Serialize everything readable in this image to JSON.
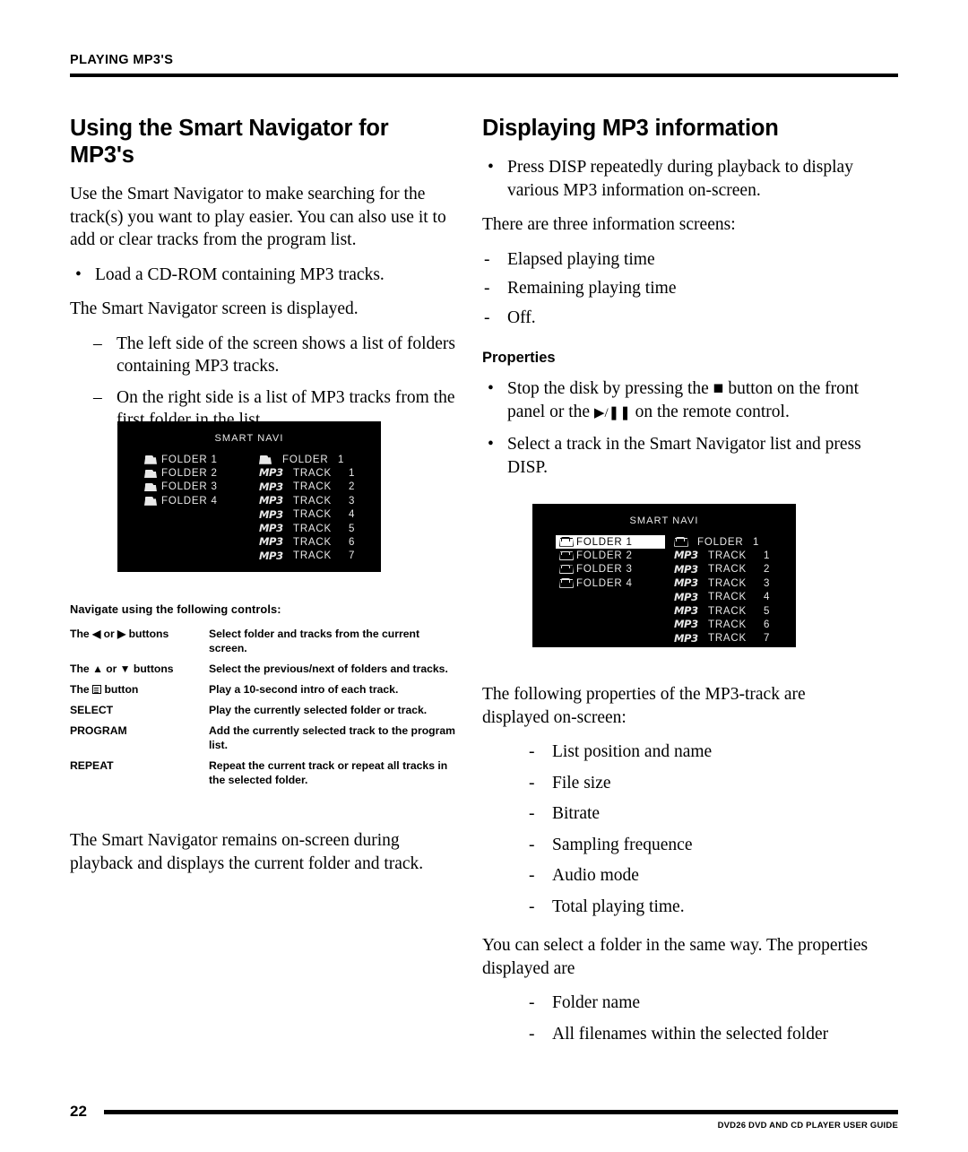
{
  "running_head": "PLAYING MP3'S",
  "left_column": {
    "title": "Using the Smart Navigator for MP3's",
    "intro": "Use the Smart Navigator to make searching for the track(s) you want to play easier. You can also use it to add or clear tracks from the program list.",
    "bullets": [
      {
        "marker": "•",
        "text": "Load a CD-ROM containing MP3 tracks."
      }
    ],
    "after_bullet": "The Smart Navigator screen is displayed.",
    "sub_items": [
      {
        "marker": "–",
        "text": "The left side of the screen shows a list of folders containing MP3 tracks."
      },
      {
        "marker": "–",
        "text": "On the right side is a list of MP3 tracks from the first folder in the list."
      }
    ],
    "tail": "The Smart Navigator remains on-screen during playback and displays the current folder and track."
  },
  "osd_screen_1": {
    "title": "SMART NAVI",
    "folders": [
      {
        "icon": "folder-icon",
        "label": "FOLDER 1",
        "highlighted": false
      },
      {
        "icon": "folder-icon",
        "label": "FOLDER 2",
        "highlighted": false
      },
      {
        "icon": "folder-icon",
        "label": "FOLDER 3",
        "highlighted": false
      },
      {
        "icon": "folder-icon",
        "label": "FOLDER 4",
        "highlighted": false
      }
    ],
    "tracks": [
      {
        "icon": "folder-icon",
        "label": "FOLDER",
        "number": "1"
      },
      {
        "icon": "mp3-icon",
        "label": "TRACK",
        "number": "1"
      },
      {
        "icon": "mp3-icon",
        "label": "TRACK",
        "number": "2"
      },
      {
        "icon": "mp3-icon",
        "label": "TRACK",
        "number": "3"
      },
      {
        "icon": "mp3-icon",
        "label": "TRACK",
        "number": "4"
      },
      {
        "icon": "mp3-icon",
        "label": "TRACK",
        "number": "5"
      },
      {
        "icon": "mp3-icon",
        "label": "TRACK",
        "number": "6"
      },
      {
        "icon": "mp3-icon",
        "label": "TRACK",
        "number": "7"
      }
    ],
    "mp3_glyph": "MP3"
  },
  "osd_screen_2": {
    "title": "SMART NAVI",
    "folders": [
      {
        "icon": "folder-icon",
        "label": "FOLDER 1",
        "highlighted": true
      },
      {
        "icon": "folder-icon",
        "label": "FOLDER 2",
        "highlighted": false
      },
      {
        "icon": "folder-icon",
        "label": "FOLDER 3",
        "highlighted": false
      },
      {
        "icon": "folder-icon",
        "label": "FOLDER 4",
        "highlighted": false
      }
    ],
    "tracks": [
      {
        "icon": "folder-icon",
        "label": "FOLDER",
        "number": "1"
      },
      {
        "icon": "mp3-icon",
        "label": "TRACK",
        "number": "1"
      },
      {
        "icon": "mp3-icon",
        "label": "TRACK",
        "number": "2"
      },
      {
        "icon": "mp3-icon",
        "label": "TRACK",
        "number": "3"
      },
      {
        "icon": "mp3-icon",
        "label": "TRACK",
        "number": "4"
      },
      {
        "icon": "mp3-icon",
        "label": "TRACK",
        "number": "5"
      },
      {
        "icon": "mp3-icon",
        "label": "TRACK",
        "number": "6"
      },
      {
        "icon": "mp3-icon",
        "label": "TRACK",
        "number": "7"
      }
    ],
    "mp3_glyph": "MP3"
  },
  "controls": {
    "heading": "Navigate using the following controls:",
    "rows": [
      {
        "key_pre": "The ",
        "key_icons": "◀ or ▶",
        "key_post": " buttons",
        "value": "Select folder and tracks from the current screen."
      },
      {
        "key_pre": "The ",
        "key_icons": "▲ or ▼",
        "key_post": " buttons",
        "value": "Select the previous/next of folders and tracks."
      },
      {
        "key_pre": "The ",
        "key_icons": "menu-icon",
        "key_post": " button",
        "value": "Play a 10-second intro of each track."
      },
      {
        "key_pre": "",
        "key_icons": "",
        "key_post": "SELECT",
        "value": "Play the currently selected folder or track."
      },
      {
        "key_pre": "",
        "key_icons": "",
        "key_post": "PROGRAM",
        "value": "Add the currently selected track to the program list."
      },
      {
        "key_pre": "",
        "key_icons": "",
        "key_post": "REPEAT",
        "value": "Repeat the current track or repeat all tracks in the selected folder."
      }
    ]
  },
  "right_column": {
    "title": "Displaying MP3 information",
    "bullets": [
      {
        "marker": "•",
        "text": "Press DISP repeatedly during playback to display various MP3 information on-screen."
      }
    ],
    "intro2": "There are three information screens:",
    "screens": [
      {
        "marker": "-",
        "text": "Elapsed playing time"
      },
      {
        "marker": "-",
        "text": "Remaining playing time"
      },
      {
        "marker": "-",
        "text": "Off."
      }
    ],
    "properties_heading": "Properties",
    "property_bullets": [
      {
        "marker": "•",
        "text_pre": "Stop the disk by pressing the ",
        "icon1": "stop-icon",
        "text_mid": " button on the front panel or the ",
        "icon2": "play-pause-icon",
        "text_post": " on the remote control."
      },
      {
        "marker": "•",
        "text": "Select a track in the Smart Navigator list and press DISP."
      }
    ],
    "props_intro": "The following properties of the MP3-track are displayed on-screen:",
    "track_props": [
      {
        "marker": "-",
        "text": "List position and name"
      },
      {
        "marker": "-",
        "text": "File size"
      },
      {
        "marker": "-",
        "text": "Bitrate"
      },
      {
        "marker": "-",
        "text": "Sampling frequence"
      },
      {
        "marker": "-",
        "text": "Audio mode"
      },
      {
        "marker": "-",
        "text": "Total playing time."
      }
    ],
    "folder_intro": "You can select a folder in the same way. The properties displayed are",
    "folder_props": [
      {
        "marker": "-",
        "text": "Folder name"
      },
      {
        "marker": "-",
        "text": "All filenames within the selected folder"
      }
    ]
  },
  "footer": {
    "page_number": "22",
    "guide_title": "DVD26 DVD AND CD PLAYER USER GUIDE"
  }
}
